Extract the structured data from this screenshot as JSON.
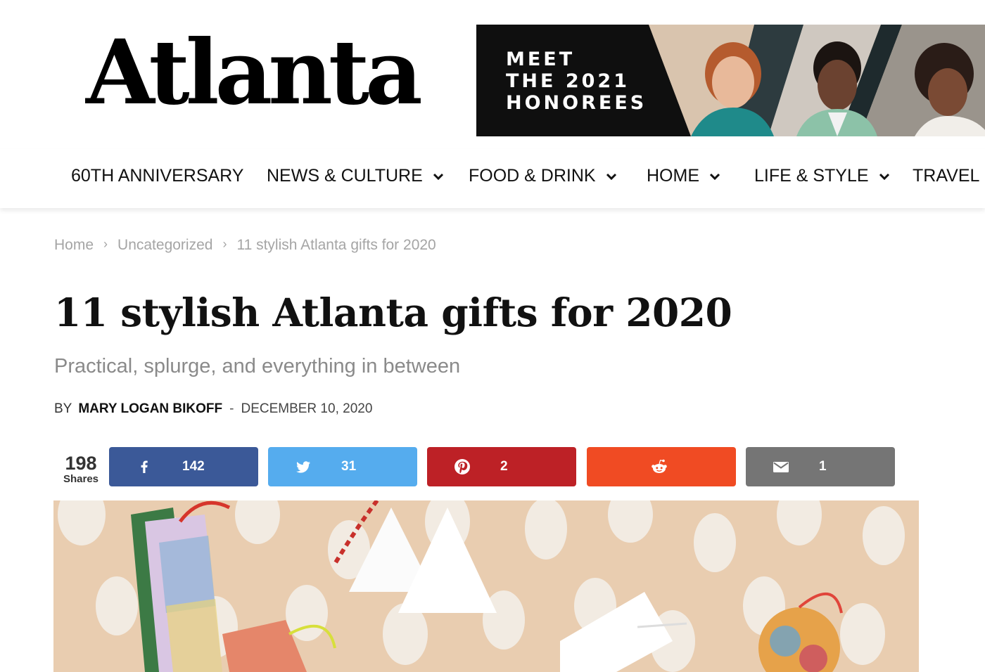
{
  "header": {
    "logo": "Atlanta",
    "banner_text": "MEET\nTHE 2021\nHONOREES"
  },
  "nav": {
    "items": [
      {
        "label": "60TH ANNIVERSARY",
        "has_dropdown": false
      },
      {
        "label": "NEWS & CULTURE",
        "has_dropdown": true
      },
      {
        "label": "FOOD & DRINK",
        "has_dropdown": true
      },
      {
        "label": "HOME",
        "has_dropdown": true
      },
      {
        "label": "LIFE & STYLE",
        "has_dropdown": true
      },
      {
        "label": "TRAVEL",
        "has_dropdown": true
      }
    ]
  },
  "breadcrumb": {
    "items": [
      "Home",
      "Uncategorized",
      "11 stylish Atlanta gifts for 2020"
    ],
    "separator": "›"
  },
  "article": {
    "title": "11 stylish Atlanta gifts for 2020",
    "subtitle": "Practical, splurge, and everything in between",
    "by_label": "BY",
    "author": "MARY LOGAN BIKOFF",
    "dash": "-",
    "date": "DECEMBER 10, 2020"
  },
  "share": {
    "total": "198",
    "total_label": "Shares",
    "buttons": [
      {
        "network": "facebook",
        "icon": "facebook-icon",
        "count": "142",
        "color": "#3b5998"
      },
      {
        "network": "twitter",
        "icon": "twitter-icon",
        "count": "31",
        "color": "#55acee"
      },
      {
        "network": "pinterest",
        "icon": "pinterest-icon",
        "count": "2",
        "color": "#bd2126"
      },
      {
        "network": "reddit",
        "icon": "reddit-icon",
        "count": "",
        "color": "#f04b23"
      },
      {
        "network": "email",
        "icon": "email-icon",
        "count": "1",
        "color": "#757575"
      }
    ]
  }
}
